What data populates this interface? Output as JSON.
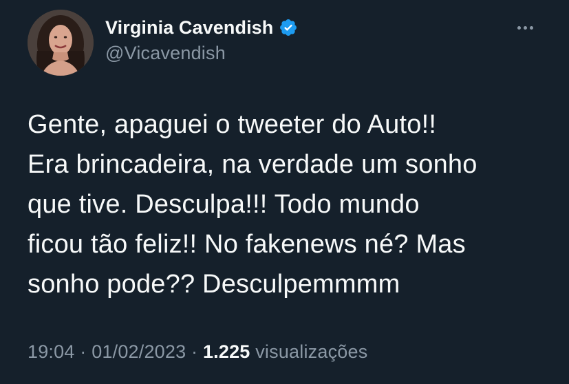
{
  "author": {
    "display_name": "Virginia Cavendish",
    "handle": "@Vicavendish",
    "verified": true,
    "verified_icon": "verified-badge-icon",
    "verified_color": "#1d9bf0"
  },
  "menu": {
    "icon": "more-horizontal-icon"
  },
  "tweet": {
    "text": "Gente, apaguei o tweeter do Auto!!\nEra brincadeira, na verdade um sonho\nque tive. Desculpa!!! Todo mundo\nficou tão feliz!! No fakenews né? Mas\nsonho pode?? Desculpemmmm"
  },
  "meta": {
    "time": "19:04",
    "separator": "·",
    "date": "01/02/2023",
    "views_count": "1.225",
    "views_label": "visualizações"
  },
  "colors": {
    "background": "#15202b",
    "text_primary": "#f7f9f9",
    "text_secondary": "#8b98a5"
  }
}
